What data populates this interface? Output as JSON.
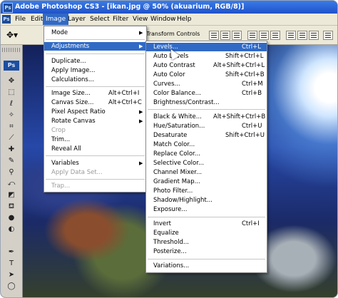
{
  "window": {
    "title": "Adobe Photoshop CS3 - [ikan.jpg @ 50% (akuarium, RGB/8)]",
    "app_icon": "Ps"
  },
  "menubar": {
    "items": [
      "File",
      "Edit",
      "Image",
      "Layer",
      "Select",
      "Filter",
      "View",
      "Window",
      "Help"
    ],
    "active": "Image",
    "app_icon": "Ps"
  },
  "optionsbar": {
    "transform_controls": "Transform Controls"
  },
  "toolbox": {
    "logo": "Ps"
  },
  "image_menu": {
    "items": [
      {
        "label": "Mode",
        "submenu": true
      },
      {
        "label": "Adjustments",
        "submenu": true,
        "highlighted": true
      },
      {
        "label": "Duplicate..."
      },
      {
        "label": "Apply Image..."
      },
      {
        "label": "Calculations..."
      },
      {
        "label": "Image Size...",
        "shortcut": "Alt+Ctrl+I"
      },
      {
        "label": "Canvas Size...",
        "shortcut": "Alt+Ctrl+C"
      },
      {
        "label": "Pixel Aspect Ratio",
        "submenu": true
      },
      {
        "label": "Rotate Canvas",
        "submenu": true
      },
      {
        "label": "Crop",
        "disabled": true
      },
      {
        "label": "Trim..."
      },
      {
        "label": "Reveal All"
      },
      {
        "label": "Variables",
        "submenu": true
      },
      {
        "label": "Apply Data Set...",
        "disabled": true
      },
      {
        "label": "Trap...",
        "disabled": true
      }
    ]
  },
  "adjustments_menu": {
    "items": [
      {
        "label": "Levels...",
        "shortcut": "Ctrl+L",
        "highlighted": true
      },
      {
        "label": "Auto Levels",
        "shortcut": "Shift+Ctrl+L"
      },
      {
        "label": "Auto Contrast",
        "shortcut": "Alt+Shift+Ctrl+L"
      },
      {
        "label": "Auto Color",
        "shortcut": "Shift+Ctrl+B"
      },
      {
        "label": "Curves...",
        "shortcut": "Ctrl+M"
      },
      {
        "label": "Color Balance...",
        "shortcut": "Ctrl+B"
      },
      {
        "label": "Brightness/Contrast..."
      },
      {
        "label": "Black & White...",
        "shortcut": "Alt+Shift+Ctrl+B"
      },
      {
        "label": "Hue/Saturation...",
        "shortcut": "Ctrl+U"
      },
      {
        "label": "Desaturate",
        "shortcut": "Shift+Ctrl+U"
      },
      {
        "label": "Match Color..."
      },
      {
        "label": "Replace Color..."
      },
      {
        "label": "Selective Color..."
      },
      {
        "label": "Channel Mixer..."
      },
      {
        "label": "Gradient Map..."
      },
      {
        "label": "Photo Filter..."
      },
      {
        "label": "Shadow/Highlight..."
      },
      {
        "label": "Exposure..."
      },
      {
        "label": "Invert",
        "shortcut": "Ctrl+I"
      },
      {
        "label": "Equalize"
      },
      {
        "label": "Threshold..."
      },
      {
        "label": "Posterize..."
      },
      {
        "label": "Variations..."
      }
    ]
  },
  "colors": {
    "highlight": "#316ac5",
    "titlebar": "#2a63d6",
    "menubar": "#ece9d8"
  }
}
